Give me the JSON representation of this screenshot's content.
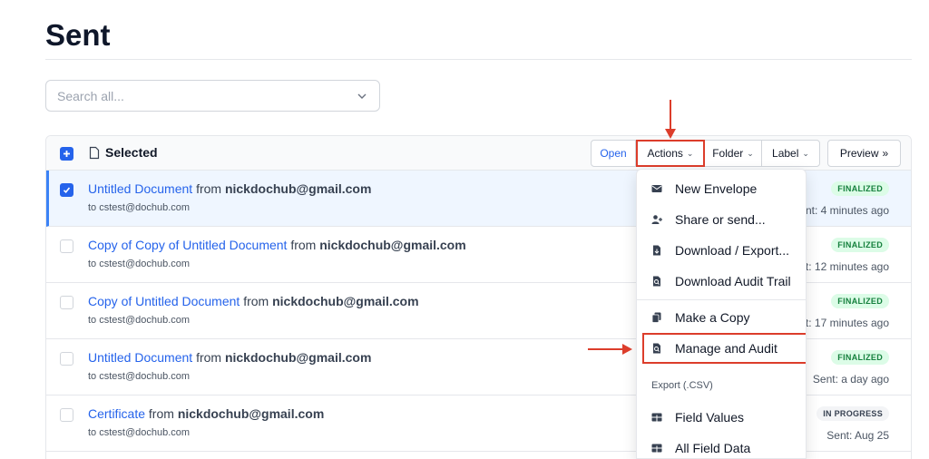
{
  "page": {
    "title": "Sent"
  },
  "search": {
    "placeholder": "Search all..."
  },
  "toolbar": {
    "selected_label": "Selected",
    "open_label": "Open",
    "actions_label": "Actions",
    "folder_label": "Folder",
    "label_label": "Label",
    "preview_label": "Preview",
    "preview_icon": "»"
  },
  "rows": [
    {
      "name": "Untitled Document",
      "from_word": "from",
      "sender": "nickdochub@gmail.com",
      "to": "to cstest@dochub.com",
      "status": "FINALIZED",
      "time": "Sent: 4 minutes ago",
      "selected": true
    },
    {
      "name": "Copy of Copy of Untitled Document",
      "from_word": "from",
      "sender": "nickdochub@gmail.com",
      "to": "to cstest@dochub.com",
      "status": "FINALIZED",
      "time": "Sent: 12 minutes ago",
      "selected": false
    },
    {
      "name": "Copy of Untitled Document",
      "from_word": "from",
      "sender": "nickdochub@gmail.com",
      "to": "to cstest@dochub.com",
      "status": "FINALIZED",
      "time": "Sent: 17 minutes ago",
      "selected": false
    },
    {
      "name": "Untitled Document",
      "from_word": "from",
      "sender": "nickdochub@gmail.com",
      "to": "to cstest@dochub.com",
      "status": "FINALIZED",
      "time": "Sent: a day ago",
      "selected": false
    },
    {
      "name": "Certificate",
      "from_word": "from",
      "sender": "nickdochub@gmail.com",
      "to": "to cstest@dochub.com",
      "status": "IN PROGRESS",
      "time": "Sent: Aug 25",
      "selected": false
    }
  ],
  "actions_menu": {
    "items": [
      {
        "label": "New Envelope",
        "icon": "envelope-icon"
      },
      {
        "label": "Share or send...",
        "icon": "add-user-icon"
      },
      {
        "label": "Download / Export...",
        "icon": "download-file-icon"
      },
      {
        "label": "Download Audit Trail",
        "icon": "audit-icon"
      },
      {
        "label": "Make a Copy",
        "icon": "copy-icon"
      },
      {
        "label": "Manage and Audit",
        "icon": "audit-icon"
      }
    ],
    "section_label": "Export (.CSV)",
    "export_items": [
      {
        "label": "Field Values",
        "icon": "table-icon"
      },
      {
        "label": "All Field Data",
        "icon": "table-icon"
      }
    ]
  },
  "colors": {
    "accent": "#2563eb",
    "annotation_red": "#dc3d2b",
    "finalized_bg": "#dcfce7",
    "finalized_text": "#15803d"
  }
}
